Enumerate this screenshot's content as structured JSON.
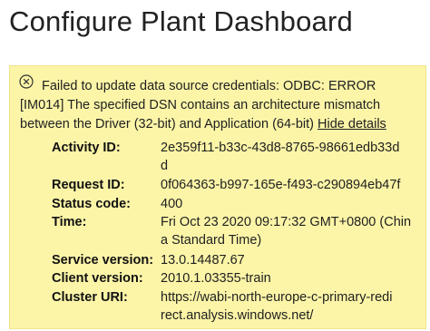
{
  "dialog": {
    "title": "Configure Plant Dashboard"
  },
  "error": {
    "icon": "error-circle-x-icon",
    "message_line1": "Failed to update data source credentials: ODBC: ERROR",
    "message_line2": "[IM014] The specified DSN contains an architecture mismatch",
    "message_line3": "between the Driver (32-bit) and Application (64-bit)",
    "hide_details_label": "Hide details",
    "details": {
      "activity_id_label": "Activity ID:",
      "activity_id_value_1": "2e359f11-b33c-43d8-8765-98661edb33d",
      "activity_id_value_2": "d",
      "request_id_label": "Request ID:",
      "request_id_value": "0f064363-b997-165e-f493-c290894eb47f",
      "status_code_label": "Status code:",
      "status_code_value": "400",
      "time_label": "Time:",
      "time_value_1": "Fri Oct 23 2020 09:17:32 GMT+0800 (Chin",
      "time_value_2": "a Standard Time)",
      "service_version_label": "Service version:",
      "service_version_value": "13.0.14487.67",
      "client_version_label": "Client version:",
      "client_version_value": "2010.1.03355-train",
      "cluster_uri_label": "Cluster URI:",
      "cluster_uri_value_1": "https://wabi-north-europe-c-primary-redi",
      "cluster_uri_value_2": "rect.analysis.windows.net/"
    }
  },
  "colors": {
    "banner_bg": "#fcf5a8",
    "text": "#1f1f1f"
  }
}
